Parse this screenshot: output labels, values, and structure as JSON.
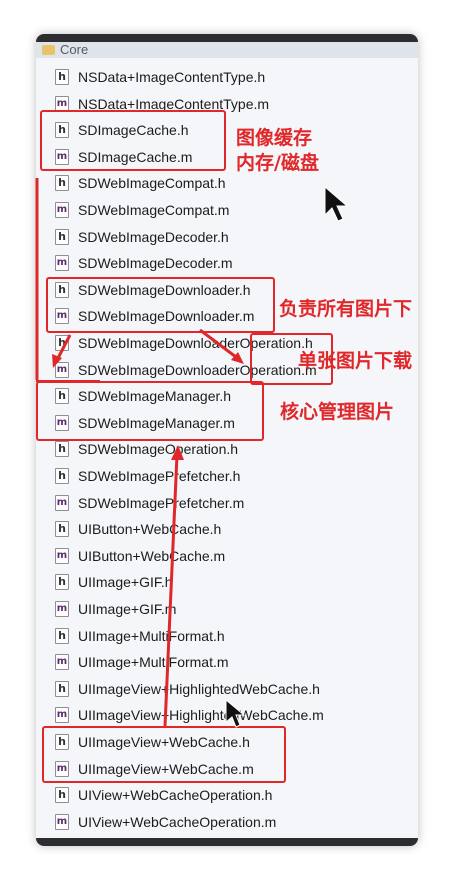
{
  "group": {
    "label": "Core",
    "icon": "folder-icon"
  },
  "files": [
    {
      "type": "h",
      "name": "NSData+ImageContentType.h"
    },
    {
      "type": "m",
      "name": "NSData+ImageContentType.m"
    },
    {
      "type": "h",
      "name": "SDImageCache.h"
    },
    {
      "type": "m",
      "name": "SDImageCache.m"
    },
    {
      "type": "h",
      "name": "SDWebImageCompat.h"
    },
    {
      "type": "m",
      "name": "SDWebImageCompat.m"
    },
    {
      "type": "h",
      "name": "SDWebImageDecoder.h"
    },
    {
      "type": "m",
      "name": "SDWebImageDecoder.m"
    },
    {
      "type": "h",
      "name": "SDWebImageDownloader.h"
    },
    {
      "type": "m",
      "name": "SDWebImageDownloader.m"
    },
    {
      "type": "h",
      "name": "SDWebImageDownloaderOperation.h"
    },
    {
      "type": "m",
      "name": "SDWebImageDownloaderOperation.m"
    },
    {
      "type": "h",
      "name": "SDWebImageManager.h"
    },
    {
      "type": "m",
      "name": "SDWebImageManager.m"
    },
    {
      "type": "h",
      "name": "SDWebImageOperation.h"
    },
    {
      "type": "h",
      "name": "SDWebImagePrefetcher.h"
    },
    {
      "type": "m",
      "name": "SDWebImagePrefetcher.m"
    },
    {
      "type": "h",
      "name": "UIButton+WebCache.h"
    },
    {
      "type": "m",
      "name": "UIButton+WebCache.m"
    },
    {
      "type": "h",
      "name": "UIImage+GIF.h"
    },
    {
      "type": "m",
      "name": "UIImage+GIF.m"
    },
    {
      "type": "h",
      "name": "UIImage+MultiFormat.h"
    },
    {
      "type": "m",
      "name": "UIImage+MultiFormat.m"
    },
    {
      "type": "h",
      "name": "UIImageView+HighlightedWebCache.h"
    },
    {
      "type": "m",
      "name": "UIImageView+HighlightedWebCache.m"
    },
    {
      "type": "h",
      "name": "UIImageView+WebCache.h"
    },
    {
      "type": "m",
      "name": "UIImageView+WebCache.m"
    },
    {
      "type": "h",
      "name": "UIView+WebCacheOperation.h"
    },
    {
      "type": "m",
      "name": "UIView+WebCacheOperation.m"
    }
  ],
  "annotations": {
    "cache_line1": "图像缓存",
    "cache_line2": "内存/磁盘",
    "downloader": "负责所有图片下",
    "operation": "单张图片下载",
    "manager": "核心管理图片"
  },
  "colors": {
    "annotation": "#e0282a"
  }
}
